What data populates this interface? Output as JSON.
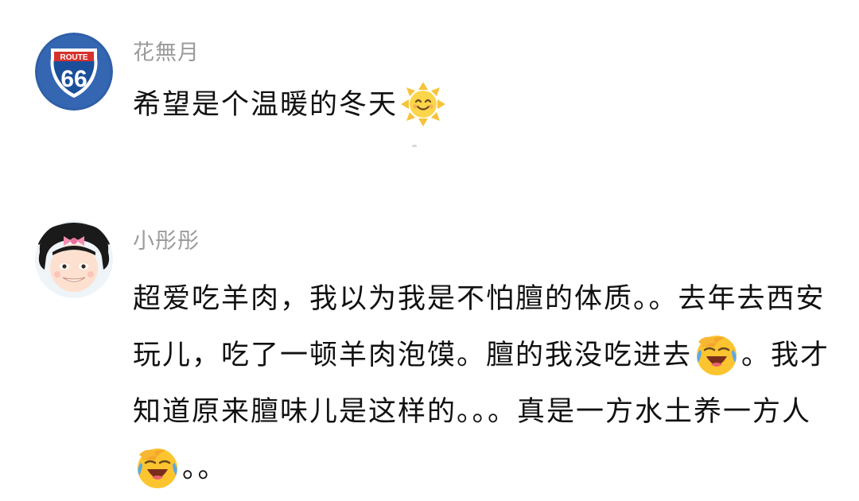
{
  "comments": [
    {
      "username": "花無月",
      "avatar": {
        "icon": "route-66-sign-icon",
        "text_top": "ROUTE",
        "text_main": "66",
        "colors": {
          "background": "#2f5fa7",
          "sign_red": "#d6312c"
        }
      },
      "segments": [
        {
          "text": "希望是个温暖的冬天"
        }
      ],
      "trailing_emoji": "smiling-sun-emoji"
    },
    {
      "username": "小彤彤",
      "avatar": {
        "icon": "cartoon-girl-avatar-icon",
        "colors": {
          "hair": "#1a1a1a",
          "bow": "#f48fb1",
          "face": "#fde0cf"
        }
      },
      "segments": [
        {
          "text": "超爱吃羊肉，我以为我是不怕膻的体质。。去年去西安玩儿，吃了一顿羊肉泡馍。膻的我没吃进去"
        },
        {
          "text": "。我才知道原来膻味儿是这样的。。。真是一方水土养一方人"
        },
        {
          "text": "。。"
        }
      ],
      "emojis": [
        "facepalm-laugh-emoji",
        "facepalm-laugh-emoji"
      ]
    }
  ],
  "colors": {
    "username": "#9b9b9b",
    "text": "#111111",
    "background": "#ffffff"
  }
}
